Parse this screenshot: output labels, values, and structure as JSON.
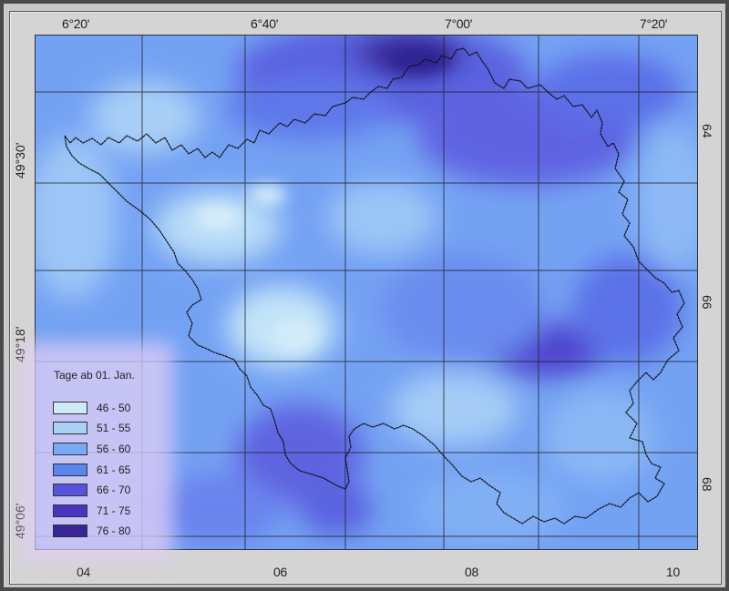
{
  "map": {
    "lon_labels_top": [
      "6°20'",
      "6°40'",
      "7°00'",
      "7°20'"
    ],
    "lat_labels_left": [
      "49°30'",
      "49°18'",
      "49°06'"
    ],
    "grid_labels_bottom": [
      "04",
      "06",
      "08",
      "10"
    ],
    "grid_labels_right": [
      "64",
      "66",
      "68"
    ]
  },
  "legend": {
    "title": "Tage ab 01. Jan.",
    "classes": [
      {
        "label": "46 - 50",
        "color": "#cfeaf7"
      },
      {
        "label": "51 - 55",
        "color": "#a9d2f6"
      },
      {
        "label": "56 - 60",
        "color": "#78aaf4"
      },
      {
        "label": "61 - 65",
        "color": "#5a84ee"
      },
      {
        "label": "66 - 70",
        "color": "#5752dc"
      },
      {
        "label": "71 - 75",
        "color": "#4a34bf"
      },
      {
        "label": "76 - 80",
        "color": "#3a2598"
      }
    ]
  }
}
